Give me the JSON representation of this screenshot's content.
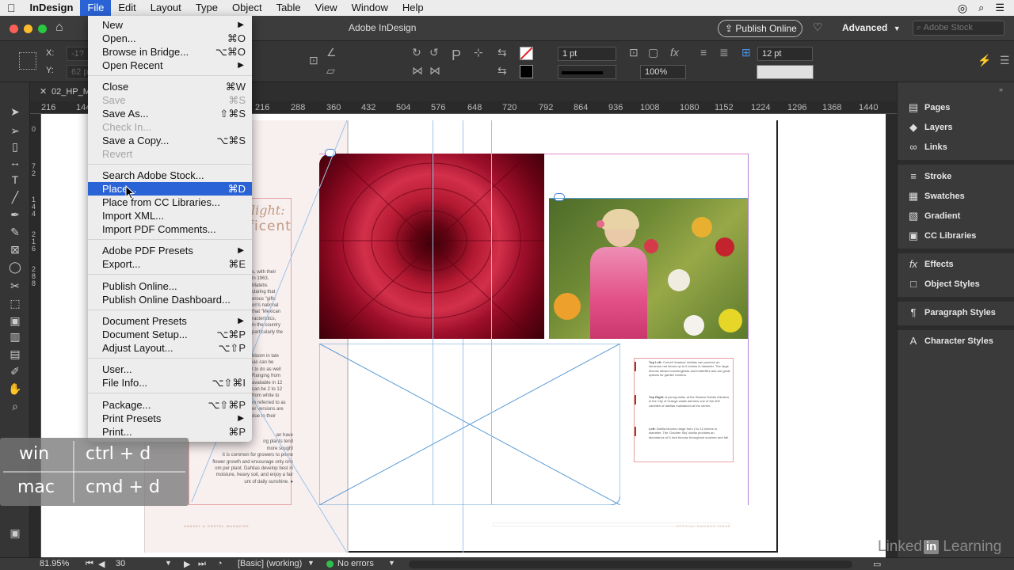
{
  "menubar": {
    "app": "InDesign",
    "items": [
      "File",
      "Edit",
      "Layout",
      "Type",
      "Object",
      "Table",
      "View",
      "Window",
      "Help"
    ],
    "active": "File"
  },
  "appbar": {
    "title": "Adobe InDesign",
    "publish_button": "Publish Online",
    "workspace": "Advanced",
    "search_placeholder": "Adobe Stock"
  },
  "controlbar": {
    "x_label": "X:",
    "y_label": "Y:",
    "x_value": "-1?",
    "y_value": "62 p",
    "stroke_weight": "1 pt",
    "opacity": "100%",
    "gutter": "12 pt"
  },
  "document_tab": "02_HP_Ma",
  "hruler": [
    "216",
    "144",
    "216",
    "288",
    "360",
    "432",
    "504",
    "576",
    "648",
    "720",
    "792",
    "864",
    "936",
    "1008",
    "1080",
    "1152",
    "1224",
    "1296",
    "1368",
    "1440"
  ],
  "vruler": [
    "0",
    "7 2",
    "1 4 4",
    "2 1 6",
    "2 8 8"
  ],
  "file_menu": {
    "groups": [
      [
        {
          "label": "New",
          "shortcut": "",
          "submenu": true,
          "disabled": false
        },
        {
          "label": "Open...",
          "shortcut": "⌘O",
          "submenu": false,
          "disabled": false
        },
        {
          "label": "Browse in Bridge...",
          "shortcut": "⌥⌘O",
          "submenu": false,
          "disabled": false
        },
        {
          "label": "Open Recent",
          "shortcut": "",
          "submenu": true,
          "disabled": false
        }
      ],
      [
        {
          "label": "Close",
          "shortcut": "⌘W",
          "submenu": false,
          "disabled": false
        },
        {
          "label": "Save",
          "shortcut": "⌘S",
          "submenu": false,
          "disabled": true
        },
        {
          "label": "Save As...",
          "shortcut": "⇧⌘S",
          "submenu": false,
          "disabled": false
        },
        {
          "label": "Check In...",
          "shortcut": "",
          "submenu": false,
          "disabled": true
        },
        {
          "label": "Save a Copy...",
          "shortcut": "⌥⌘S",
          "submenu": false,
          "disabled": false
        },
        {
          "label": "Revert",
          "shortcut": "",
          "submenu": false,
          "disabled": true
        }
      ],
      [
        {
          "label": "Search Adobe Stock...",
          "shortcut": "",
          "submenu": false,
          "disabled": false
        },
        {
          "label": "Place...",
          "shortcut": "⌘D",
          "submenu": false,
          "disabled": false,
          "highlighted": true
        },
        {
          "label": "Place from CC Libraries...",
          "shortcut": "",
          "submenu": false,
          "disabled": false
        },
        {
          "label": "Import XML...",
          "shortcut": "",
          "submenu": false,
          "disabled": false
        },
        {
          "label": "Import PDF Comments...",
          "shortcut": "",
          "submenu": false,
          "disabled": false
        }
      ],
      [
        {
          "label": "Adobe PDF Presets",
          "shortcut": "",
          "submenu": true,
          "disabled": false
        },
        {
          "label": "Export...",
          "shortcut": "⌘E",
          "submenu": false,
          "disabled": false
        }
      ],
      [
        {
          "label": "Publish Online...",
          "shortcut": "",
          "submenu": false,
          "disabled": false
        },
        {
          "label": "Publish Online Dashboard...",
          "shortcut": "",
          "submenu": false,
          "disabled": false
        }
      ],
      [
        {
          "label": "Document Presets",
          "shortcut": "",
          "submenu": true,
          "disabled": false
        },
        {
          "label": "Document Setup...",
          "shortcut": "⌥⌘P",
          "submenu": false,
          "disabled": false
        },
        {
          "label": "Adjust Layout...",
          "shortcut": "⌥⇧P",
          "submenu": false,
          "disabled": false
        }
      ],
      [
        {
          "label": "User...",
          "shortcut": "",
          "submenu": false,
          "disabled": false
        },
        {
          "label": "File Info...",
          "shortcut": "⌥⇧⌘I",
          "submenu": false,
          "disabled": false
        }
      ],
      [
        {
          "label": "Package...",
          "shortcut": "⌥⇧⌘P",
          "submenu": false,
          "disabled": false
        },
        {
          "label": "Print Presets",
          "shortcut": "",
          "submenu": true,
          "disabled": false
        },
        {
          "label": "Print...",
          "shortcut": "⌘P",
          "submenu": false,
          "disabled": false
        }
      ]
    ]
  },
  "panels": [
    {
      "label": "Pages",
      "icon": "pages-icon",
      "glyph": "▤"
    },
    {
      "label": "Layers",
      "icon": "layers-icon",
      "glyph": "◆"
    },
    {
      "label": "Links",
      "icon": "links-icon",
      "glyph": "∞"
    },
    {
      "label": "Stroke",
      "icon": "stroke-icon",
      "glyph": "≡"
    },
    {
      "label": "Swatches",
      "icon": "swatches-icon",
      "glyph": "▦"
    },
    {
      "label": "Gradient",
      "icon": "gradient-icon",
      "glyph": "▧"
    },
    {
      "label": "CC Libraries",
      "icon": "cc-libraries-icon",
      "glyph": "▣"
    },
    {
      "label": "Effects",
      "icon": "effects-icon",
      "glyph": "fx"
    },
    {
      "label": "Object Styles",
      "icon": "object-styles-icon",
      "glyph": "□"
    },
    {
      "label": "Paragraph Styles",
      "icon": "paragraph-styles-icon",
      "glyph": "¶"
    },
    {
      "label": "Character Styles",
      "icon": "character-styles-icon",
      "glyph": "A"
    }
  ],
  "page_text": {
    "headline_1": "light:",
    "headline_2": "ficent",
    "footer_left": "HANSEL & GRETEL MAGAZINE",
    "footer_right": "SPECIAL SUMMER ISSUE",
    "body_fragments": [
      "s, with their",
      "in 1963,",
      "Matebs",
      "claring that",
      "erous \"gifts",
      "on's national",
      "that \"Mexican",
      "racteristics,",
      "in the country",
      "particularly the",
      "bloom in late",
      "ias can be",
      "t to do as well",
      "Ranging from",
      "available in 12",
      "can be 2 to 12",
      "from white to",
      "re referred to as",
      "er versions are",
      "due to their",
      "an have",
      "ng plants tend",
      "more sought",
      "it is common for growers to prune",
      "flower growth and encourage only one",
      "om per plant. Dahlias develop best in",
      "moisture, heavy soil, and enjoy a fair",
      "unt of daily sunshine. ●"
    ],
    "captions": [
      {
        "lead": "Top Left:",
        "text": "Cornell 'shadow' dahlias can produce an immense red bloom up to 6 inches in diameter. The large blooms attract hummingbirds and butterflies and are great options for garden borders."
      },
      {
        "lead": "Top Right:",
        "text": "A young visitor at the Sirance Dahlia Gardens in the City of Orange walks admires one of the 300 varieties of dahlias maintained at the center."
      },
      {
        "lead": "Left:",
        "text": "Dahlia blooms range from 2 to 12 inches in diameter. The 'October Sky' dahlia provides an abundance of 6 inch blooms throughout summer and fall."
      }
    ]
  },
  "shortcut_overlay": {
    "win_label": "win",
    "win_keys": "ctrl + d",
    "mac_label": "mac",
    "mac_keys": "cmd + d"
  },
  "status": {
    "zoom": "81.95%",
    "page": "30",
    "style": "[Basic] (working)",
    "errors": "No errors"
  },
  "watermark": {
    "prefix": "Linked",
    "in": "in",
    "suffix": "Learning"
  },
  "colors": {
    "accent": "#2a63d6",
    "frame_blue": "#5b9bd5",
    "pink_guide": "#e08ad0",
    "accent_red": "#c0392b"
  }
}
